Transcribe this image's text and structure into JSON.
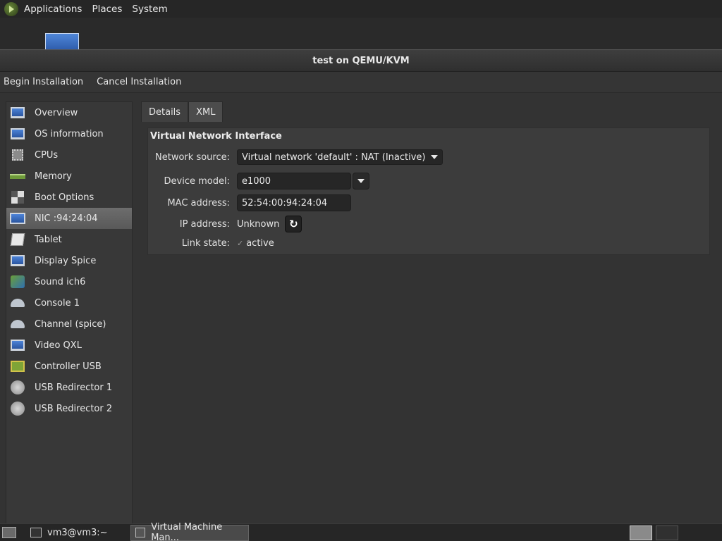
{
  "top_panel": {
    "menus": [
      "Applications",
      "Places",
      "System"
    ]
  },
  "window": {
    "title": "test on QEMU/KVM",
    "toolbar": {
      "begin_label": "Begin Installation",
      "cancel_label": "Cancel Installation"
    },
    "sidebar": {
      "items": [
        {
          "label": "Overview",
          "icon": "monitor-icon"
        },
        {
          "label": "OS information",
          "icon": "monitor-icon"
        },
        {
          "label": "CPUs",
          "icon": "cpu-chip-icon"
        },
        {
          "label": "Memory",
          "icon": "memory-icon"
        },
        {
          "label": "Boot Options",
          "icon": "boot-options-icon"
        },
        {
          "label": "NIC :94:24:04",
          "icon": "network-card-icon",
          "selected": true
        },
        {
          "label": "Tablet",
          "icon": "tablet-icon"
        },
        {
          "label": "Display Spice",
          "icon": "monitor-icon"
        },
        {
          "label": "Sound ich6",
          "icon": "sound-card-icon"
        },
        {
          "label": "Console 1",
          "icon": "serial-port-icon"
        },
        {
          "label": "Channel (spice)",
          "icon": "serial-port-icon"
        },
        {
          "label": "Video QXL",
          "icon": "monitor-icon"
        },
        {
          "label": "Controller USB",
          "icon": "controller-icon"
        },
        {
          "label": "USB Redirector 1",
          "icon": "usb-icon"
        },
        {
          "label": "USB Redirector 2",
          "icon": "usb-icon"
        }
      ]
    },
    "tabs": [
      {
        "label": "Details",
        "active": true
      },
      {
        "label": "XML",
        "active": false
      }
    ],
    "details": {
      "section_title": "Virtual Network Interface",
      "network_source_label": "Network source:",
      "network_source_value": "Virtual network 'default' : NAT (Inactive)",
      "device_model_label": "Device model:",
      "device_model_value": "e1000",
      "mac_label": "MAC address:",
      "mac_value": "52:54:00:94:24:04",
      "ip_label": "IP address:",
      "ip_value": "Unknown",
      "link_label": "Link state:",
      "link_value": "active",
      "link_checked": true
    }
  },
  "bottom_panel": {
    "tasks": [
      {
        "label": "vm3@vm3:~",
        "active": false
      },
      {
        "label": "Virtual Machine Man...",
        "active": true
      }
    ]
  },
  "colors": {
    "background": "#2d2d2d",
    "panel": "#262626",
    "selected_item": "#6d6d6d",
    "entry": "#262626"
  }
}
